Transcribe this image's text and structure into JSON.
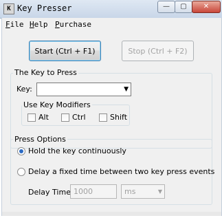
{
  "window": {
    "icon_letter": "K",
    "title": "Key Presser",
    "controls": {
      "minimize": "—",
      "maximize": "▢",
      "close": "✕"
    }
  },
  "menu": [
    {
      "mnemonic": "F",
      "rest": "ile"
    },
    {
      "mnemonic": "H",
      "rest": "elp"
    },
    {
      "mnemonic": "P",
      "rest": "urchase"
    }
  ],
  "buttons": {
    "start": "Start (Ctrl + F1)",
    "stop": "Stop (Ctrl + F2)"
  },
  "key_group": {
    "title": "The Key to Press",
    "key_label": "Key:",
    "key_value": "",
    "arrow": "▼",
    "modifiers_title": "Use Key Modifiers",
    "modifiers": [
      {
        "label": "Alt",
        "checked": false
      },
      {
        "label": "Ctrl",
        "checked": false
      },
      {
        "label": "Shift",
        "checked": false
      }
    ]
  },
  "press_group": {
    "title": "Press Options",
    "hold_label": "Hold the key continuously",
    "delay_label": "Delay a fixed time between two key press events",
    "selected": "hold",
    "delay_time_label": "Delay Time:",
    "delay_value": "1000",
    "unit_value": "ms",
    "unit_arrow": "▼"
  }
}
